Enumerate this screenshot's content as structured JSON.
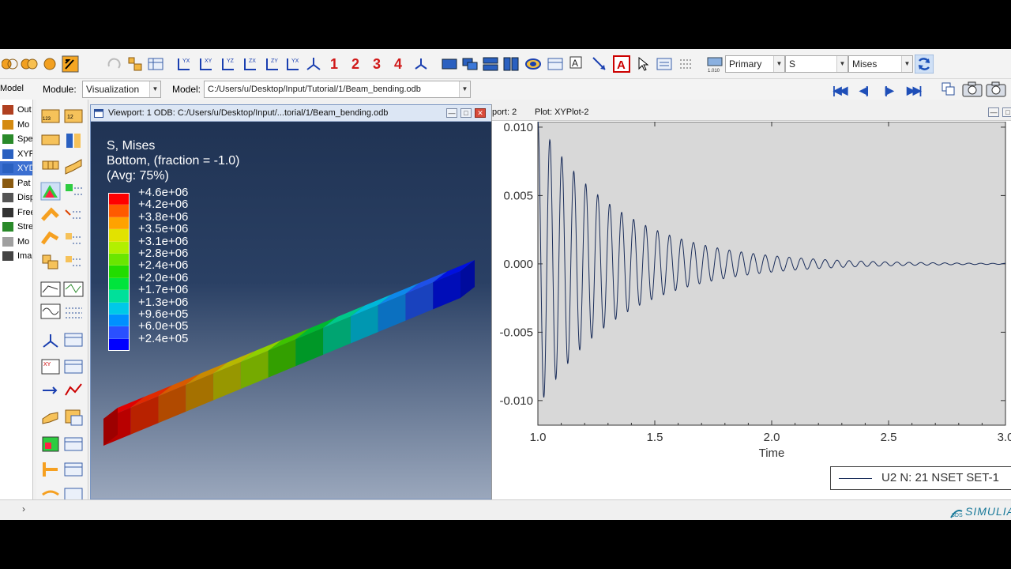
{
  "toolbar": {
    "view_numbers": [
      "1",
      "2",
      "3",
      "4"
    ],
    "primary_variable": "Primary",
    "field_variable": "S",
    "invariant": "Mises"
  },
  "context_bar": {
    "module_label": "Module:",
    "module_value": "Visualization",
    "model_label": "Model:",
    "model_value": "C:/Users/u/Desktop/Input/Tutorial/1/Beam_bending.odb"
  },
  "tabs": {
    "model": "Model"
  },
  "tree": {
    "items": [
      {
        "label": "Out",
        "icon": "output-icon"
      },
      {
        "label": "Mo",
        "icon": "model-icon"
      },
      {
        "label": "Spe",
        "icon": "spectrum-icon"
      },
      {
        "label": "XYP",
        "icon": "xyplot-icon"
      },
      {
        "label": "XYD",
        "icon": "xydata-icon"
      },
      {
        "label": "Pat",
        "icon": "path-icon"
      },
      {
        "label": "Disp",
        "icon": "display-group-icon"
      },
      {
        "label": "Free",
        "icon": "free-body-icon"
      },
      {
        "label": "Stre",
        "icon": "stream-icon"
      },
      {
        "label": "Mo",
        "icon": "movie-icon"
      },
      {
        "label": "Ima",
        "icon": "image-icon"
      }
    ]
  },
  "viewport1": {
    "title": "Viewport: 1    ODB: C:/Users/u/Desktop/Input/...torial/1/Beam_bending.odb",
    "legend_line1": "S, Mises",
    "legend_line2": "Bottom, (fraction = -1.0)",
    "legend_line3": "(Avg: 75%)",
    "legend_values": [
      "+4.6e+06",
      "+4.2e+06",
      "+3.8e+06",
      "+3.5e+06",
      "+3.1e+06",
      "+2.8e+06",
      "+2.4e+06",
      "+2.0e+06",
      "+1.7e+06",
      "+1.3e+06",
      "+9.6e+05",
      "+6.0e+05",
      "+2.4e+05"
    ],
    "legend_colors": [
      "#ff0000",
      "#ff5a00",
      "#ffa200",
      "#e2e200",
      "#b2f000",
      "#6ae600",
      "#22dc00",
      "#00e43c",
      "#00e09a",
      "#00c8e8",
      "#0090ff",
      "#2a50ff",
      "#0000ff"
    ],
    "beam_colors": [
      "#e00000",
      "#e02a00",
      "#d85a00",
      "#c98a00",
      "#b8b800",
      "#8fcf00",
      "#3ec200",
      "#00b830",
      "#00c88a",
      "#00b8d8",
      "#0e88ea",
      "#1e50e8",
      "#0010e0"
    ]
  },
  "viewport2": {
    "title_left": "port: 2",
    "title_plot": "Plot: XYPlot-2",
    "legend_text": "U2 N: 21 NSET SET-1",
    "brand": "SIMULIA"
  },
  "chart_data": {
    "type": "line",
    "title": "",
    "xlabel": "Time",
    "ylabel": "",
    "xlim": [
      1.0,
      3.0
    ],
    "ylim": [
      -0.0118,
      0.0104
    ],
    "x_ticks": [
      "1.0",
      "1.5",
      "2.0",
      "2.5",
      "3.0"
    ],
    "y_ticks": [
      "0.010",
      "0.005",
      "0.000",
      "-0.005",
      "-0.010"
    ],
    "series": [
      {
        "name": "U2 N: 21 NSET SET-1",
        "color": "#1a2d5a",
        "x_start": 1.0,
        "x_end": 3.0,
        "initial_amplitude": 0.0105,
        "period": 0.0512,
        "decay_time": 0.35
      }
    ]
  }
}
